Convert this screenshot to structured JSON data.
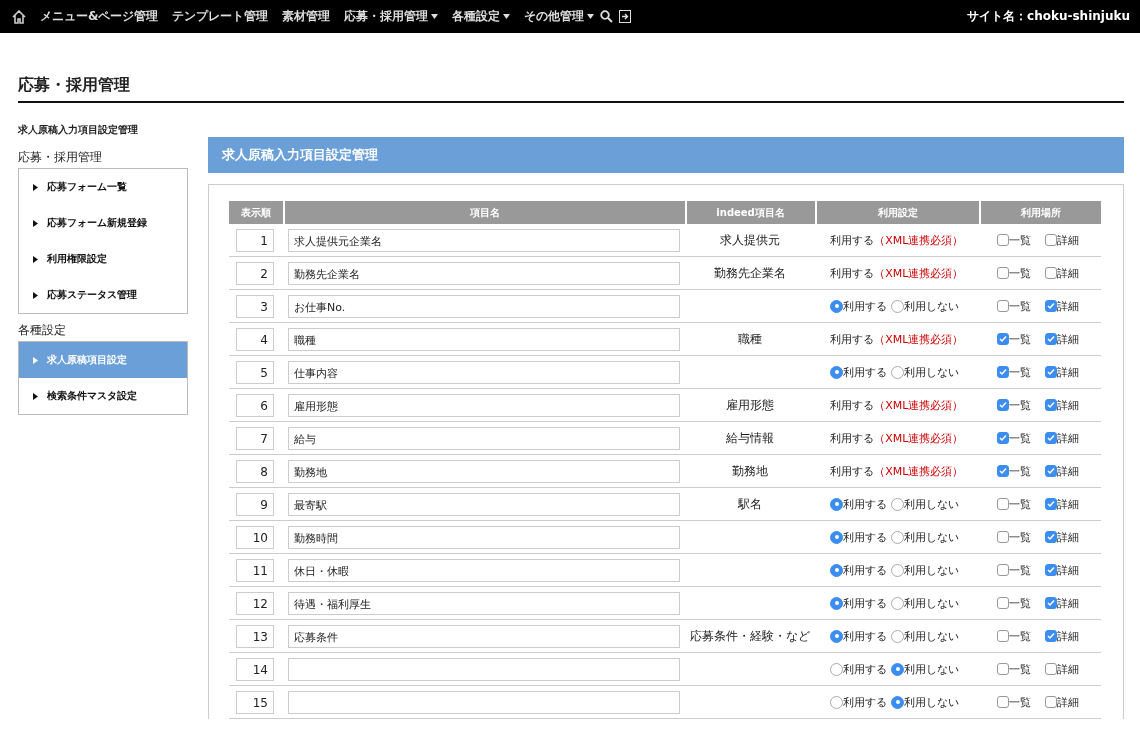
{
  "nav": {
    "items": [
      {
        "label": "メニュー&ページ管理",
        "dropdown": false
      },
      {
        "label": "テンプレート管理",
        "dropdown": false
      },
      {
        "label": "素材管理",
        "dropdown": false
      },
      {
        "label": "応募・採用管理",
        "dropdown": true
      },
      {
        "label": "各種設定",
        "dropdown": true
      },
      {
        "label": "その他管理",
        "dropdown": true
      }
    ],
    "site": "サイト名：choku-shinjuku"
  },
  "page_title": "応募・採用管理",
  "breadcrumb": "求人原稿入力項目設定管理",
  "sidebar": [
    {
      "heading": "応募・採用管理",
      "items": [
        {
          "label": "応募フォーム一覧",
          "selected": false
        },
        {
          "label": "応募フォーム新規登録",
          "selected": false
        },
        {
          "label": "利用権限設定",
          "selected": false
        },
        {
          "label": "応募ステータス管理",
          "selected": false
        }
      ]
    },
    {
      "heading": "各種設定",
      "items": [
        {
          "label": "求人原稿項目設定",
          "selected": true
        },
        {
          "label": "検索条件マスタ設定",
          "selected": false
        }
      ]
    }
  ],
  "panel_title": "求人原稿入力項目設定管理",
  "table": {
    "columns": [
      "表示順",
      "項目名",
      "indeed項目名",
      "利用設定",
      "利用場所"
    ],
    "rows": [
      {
        "order": "1",
        "name": "求人提供元企業名",
        "indeed": "求人提供元",
        "usage": {
          "kind": "fixed",
          "label": "利用する",
          "note": "（XML連携必須）"
        },
        "places": [
          {
            "label": "一覧",
            "checked": false
          },
          {
            "label": "詳細",
            "checked": false
          }
        ]
      },
      {
        "order": "2",
        "name": "勤務先企業名",
        "indeed": "勤務先企業名",
        "usage": {
          "kind": "fixed",
          "label": "利用する",
          "note": "（XML連携必須）"
        },
        "places": [
          {
            "label": "一覧",
            "checked": false
          },
          {
            "label": "詳細",
            "checked": false
          }
        ]
      },
      {
        "order": "3",
        "name": "お仕事No.",
        "usage": {
          "kind": "radio",
          "options": [
            {
              "label": "利用する",
              "selected": true
            },
            {
              "label": "利用しない",
              "selected": false
            }
          ]
        },
        "places": [
          {
            "label": "一覧",
            "checked": false
          },
          {
            "label": "詳細",
            "checked": true
          }
        ]
      },
      {
        "order": "4",
        "name": "職種",
        "indeed": "職種",
        "usage": {
          "kind": "fixed",
          "label": "利用する",
          "note": "（XML連携必須）"
        },
        "places": [
          {
            "label": "一覧",
            "checked": true
          },
          {
            "label": "詳細",
            "checked": true
          }
        ]
      },
      {
        "order": "5",
        "name": "仕事内容",
        "usage": {
          "kind": "radio",
          "options": [
            {
              "label": "利用する",
              "selected": true
            },
            {
              "label": "利用しない",
              "selected": false
            }
          ]
        },
        "places": [
          {
            "label": "一覧",
            "checked": true
          },
          {
            "label": "詳細",
            "checked": true
          }
        ]
      },
      {
        "order": "6",
        "name": "雇用形態",
        "indeed": "雇用形態",
        "usage": {
          "kind": "fixed",
          "label": "利用する",
          "note": "（XML連携必須）"
        },
        "places": [
          {
            "label": "一覧",
            "checked": true
          },
          {
            "label": "詳細",
            "checked": true
          }
        ]
      },
      {
        "order": "7",
        "name": "給与",
        "indeed": "給与情報",
        "usage": {
          "kind": "fixed",
          "label": "利用する",
          "note": "（XML連携必須）"
        },
        "places": [
          {
            "label": "一覧",
            "checked": true
          },
          {
            "label": "詳細",
            "checked": true
          }
        ]
      },
      {
        "order": "8",
        "name": "勤務地",
        "indeed": "勤務地",
        "usage": {
          "kind": "fixed",
          "label": "利用する",
          "note": "（XML連携必須）"
        },
        "places": [
          {
            "label": "一覧",
            "checked": true
          },
          {
            "label": "詳細",
            "checked": true
          }
        ]
      },
      {
        "order": "9",
        "name": "最寄駅",
        "indeed": "駅名",
        "usage": {
          "kind": "radio",
          "options": [
            {
              "label": "利用する",
              "selected": true
            },
            {
              "label": "利用しない",
              "selected": false
            }
          ]
        },
        "places": [
          {
            "label": "一覧",
            "checked": false
          },
          {
            "label": "詳細",
            "checked": true
          }
        ]
      },
      {
        "order": "10",
        "name": "勤務時間",
        "usage": {
          "kind": "radio",
          "options": [
            {
              "label": "利用する",
              "selected": true
            },
            {
              "label": "利用しない",
              "selected": false
            }
          ]
        },
        "places": [
          {
            "label": "一覧",
            "checked": false
          },
          {
            "label": "詳細",
            "checked": true
          }
        ]
      },
      {
        "order": "11",
        "name": "休日・休暇",
        "usage": {
          "kind": "radio",
          "options": [
            {
              "label": "利用する",
              "selected": true
            },
            {
              "label": "利用しない",
              "selected": false
            }
          ]
        },
        "places": [
          {
            "label": "一覧",
            "checked": false
          },
          {
            "label": "詳細",
            "checked": true
          }
        ]
      },
      {
        "order": "12",
        "name": "待遇・福利厚生",
        "usage": {
          "kind": "radio",
          "options": [
            {
              "label": "利用する",
              "selected": true
            },
            {
              "label": "利用しない",
              "selected": false
            }
          ]
        },
        "places": [
          {
            "label": "一覧",
            "checked": false
          },
          {
            "label": "詳細",
            "checked": true
          }
        ]
      },
      {
        "order": "13",
        "name": "応募条件",
        "indeed": "応募条件・経験・など",
        "usage": {
          "kind": "radio",
          "options": [
            {
              "label": "利用する",
              "selected": true
            },
            {
              "label": "利用しない",
              "selected": false
            }
          ]
        },
        "places": [
          {
            "label": "一覧",
            "checked": false
          },
          {
            "label": "詳細",
            "checked": true
          }
        ]
      },
      {
        "order": "14",
        "usage": {
          "kind": "radio",
          "options": [
            {
              "label": "利用する",
              "selected": false
            },
            {
              "label": "利用しない",
              "selected": true
            }
          ]
        },
        "places": [
          {
            "label": "一覧",
            "checked": false
          },
          {
            "label": "詳細",
            "checked": false
          }
        ]
      },
      {
        "order": "15",
        "usage": {
          "kind": "radio",
          "options": [
            {
              "label": "利用する",
              "selected": false
            },
            {
              "label": "利用しない",
              "selected": true
            }
          ]
        },
        "places": [
          {
            "label": "一覧",
            "checked": false
          },
          {
            "label": "詳細",
            "checked": false
          }
        ]
      }
    ]
  }
}
